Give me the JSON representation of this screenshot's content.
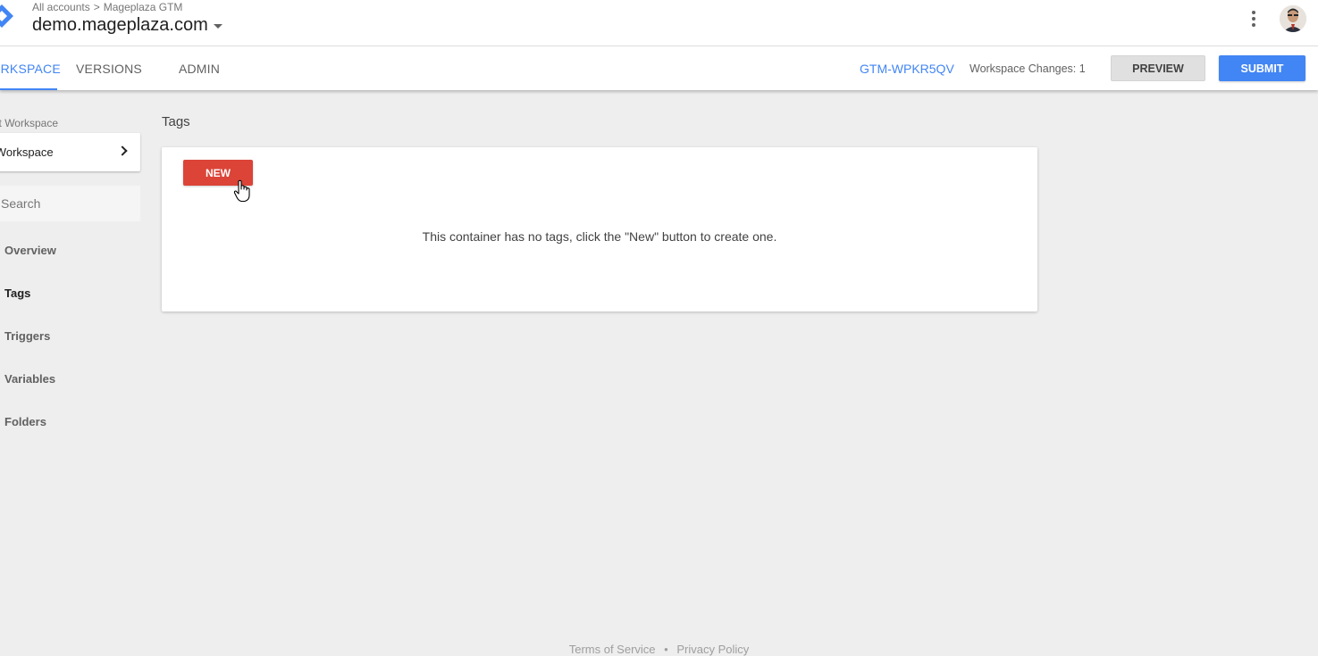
{
  "header": {
    "breadcrumb": [
      "All accounts",
      "Mageplaza GTM"
    ],
    "breadcrumb_separator": ">",
    "container_name": "demo.mageplaza.com"
  },
  "nav": {
    "tabs": [
      {
        "label": "WORKSPACE",
        "active": true
      },
      {
        "label": "VERSIONS",
        "active": false
      },
      {
        "label": "ADMIN",
        "active": false
      }
    ],
    "container_id": "GTM-WPKR5QV",
    "workspace_changes": "Workspace Changes: 1",
    "preview_label": "PREVIEW",
    "submit_label": "SUBMIT"
  },
  "sidebar": {
    "workspace_label": "Current Workspace",
    "workspace_name": "Default Workspace",
    "search_placeholder": "Search",
    "items": [
      {
        "label": "Overview",
        "active": false
      },
      {
        "label": "Tags",
        "active": true
      },
      {
        "label": "Triggers",
        "active": false
      },
      {
        "label": "Variables",
        "active": false
      },
      {
        "label": "Folders",
        "active": false
      }
    ]
  },
  "main": {
    "title": "Tags",
    "new_label": "NEW",
    "empty_message": "This container has no tags, click the \"New\" button to create one."
  },
  "footer": {
    "terms": "Terms of Service",
    "separator": "•",
    "privacy": "Privacy Policy"
  },
  "colors": {
    "accent": "#4285f4",
    "new_button": "#db4437",
    "background": "#eeeeee"
  },
  "icons": [
    "gtm-logo-icon",
    "chevron-down-icon",
    "more-vert-icon",
    "chevron-right-icon",
    "hand-cursor-icon"
  ]
}
